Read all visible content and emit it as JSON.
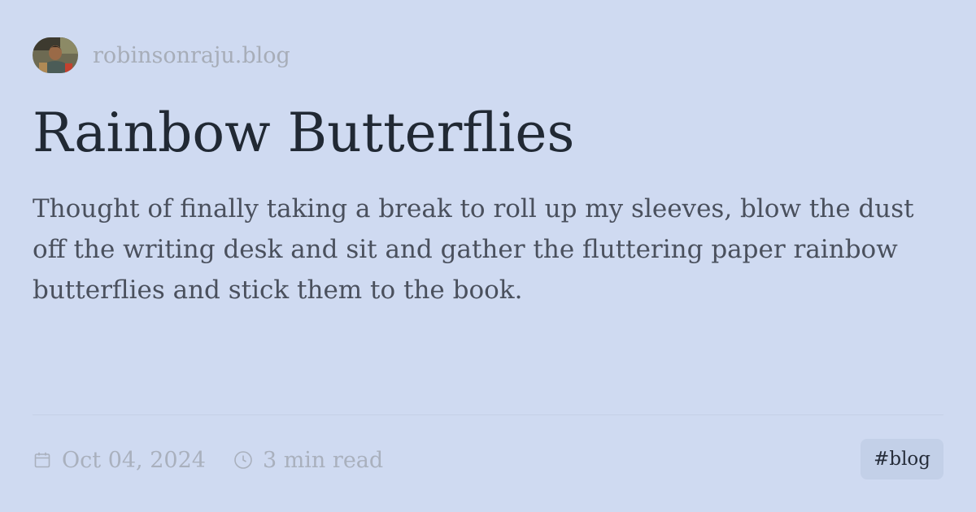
{
  "header": {
    "site_name": "robinsonraju.blog"
  },
  "post": {
    "title": "Rainbow Butterflies",
    "excerpt": "Thought of finally taking a break to roll up my sleeves, blow the dust off the writing desk and sit and gather the fluttering paper rainbow butterflies and stick them to the book.",
    "date": "Oct 04, 2024",
    "read_time": "3 min read",
    "tag": "#blog"
  },
  "icons": {
    "date": "calendar-icon",
    "read_time": "clock-icon"
  },
  "colors": {
    "background": "#cfdaf1",
    "title": "#212934",
    "excerpt": "#4a505d",
    "muted": "#a9b0bd",
    "tag_background": "#c3d0e8"
  }
}
